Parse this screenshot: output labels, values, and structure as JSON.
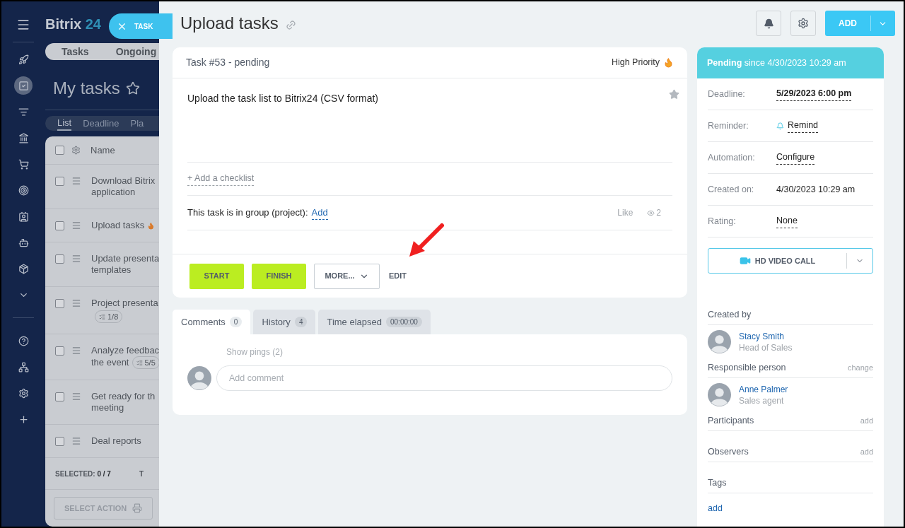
{
  "background": {
    "logo": {
      "name": "Bitrix",
      "number": "24"
    },
    "close_task": {
      "label": "TASK"
    },
    "nav": [
      {
        "kind": "menu",
        "selected": false
      },
      {
        "kind": "feed",
        "selected": false
      },
      {
        "kind": "tasks",
        "selected": true
      },
      {
        "kind": "funnel",
        "selected": false
      },
      {
        "kind": "bank",
        "selected": false
      },
      {
        "kind": "cart",
        "selected": false
      },
      {
        "kind": "target",
        "selected": false
      },
      {
        "kind": "contact",
        "selected": false
      },
      {
        "kind": "robot",
        "selected": false
      },
      {
        "kind": "box",
        "selected": false
      },
      {
        "kind": "more",
        "selected": false
      },
      {
        "kind": "help",
        "selected": false
      },
      {
        "kind": "network",
        "selected": false
      },
      {
        "kind": "settings",
        "selected": false
      },
      {
        "kind": "add",
        "selected": false
      }
    ],
    "top_tabs": [
      {
        "label": "Tasks"
      },
      {
        "label": "Ongoing"
      }
    ],
    "page_title": "My tasks",
    "view_tabs": [
      {
        "label": "List",
        "selected": true
      },
      {
        "label": "Deadline",
        "selected": false
      },
      {
        "label": "Pla",
        "selected": false
      }
    ],
    "list_header": "Name",
    "header_checked": false,
    "rows": [
      {
        "title": "Download Bitrix",
        "title_line_2": "application",
        "hot": false,
        "checked": false
      },
      {
        "title": "Upload tasks",
        "hot": true,
        "checked": false
      },
      {
        "title": "Update presenta",
        "title_line_2": "templates",
        "hot": false,
        "checked": false
      },
      {
        "title": "Project presenta",
        "badge": "1/8",
        "hot": false,
        "checked": false
      },
      {
        "title": "Analyze feedbac",
        "title_line_2": "the event",
        "badge": "5/5",
        "hot": false,
        "checked": false
      },
      {
        "title": "Get ready for th",
        "title_line_2": "meeting",
        "hot": false,
        "checked": false
      },
      {
        "title": "Deal reports",
        "hot": false,
        "checked": false
      }
    ],
    "footer": {
      "selected_label": "SELECTED:",
      "selected_value": "0 / 7",
      "total_label": "T"
    },
    "action_button": "SELECT ACTION"
  },
  "panel": {
    "title": "Upload tasks",
    "add_button": "ADD",
    "task": {
      "header": "Task #53 - pending",
      "priority": "High Priority",
      "description": "Upload the task list to Bitrix24 (CSV format)",
      "checklist_link": "+ Add a checklist",
      "group_label": "This task is in group (project):",
      "group_link": "Add",
      "like": "Like",
      "views": "2",
      "buttons": [
        {
          "label": "START",
          "kind": "primary"
        },
        {
          "label": "FINISH",
          "kind": "primary"
        },
        {
          "label": "MORE...",
          "kind": "menu"
        },
        {
          "label": "EDIT",
          "kind": "plain"
        }
      ]
    },
    "tabs": [
      {
        "label": "Comments",
        "count": "0",
        "selected": true
      },
      {
        "label": "History",
        "count": "4",
        "selected": false
      },
      {
        "label": "Time elapsed",
        "count": "00:00:00",
        "selected": false
      }
    ],
    "comments": {
      "show_pings": "Show pings (2)",
      "placeholder": "Add comment"
    },
    "status": "**Pending** since 4/30/2023 10:29 am",
    "fields": [
      {
        "label": "Deadline:",
        "value": "5/29/2023 6:00 pm",
        "kind": "deadline"
      },
      {
        "label": "Reminder:",
        "value": "Remind",
        "kind": "reminder"
      },
      {
        "label": "Automation:",
        "value": "Configure",
        "kind": "link"
      },
      {
        "label": "Created on:",
        "value": "4/30/2023 10:29 am",
        "kind": "text"
      },
      {
        "label": "Rating:",
        "value": "None",
        "kind": "link"
      }
    ],
    "video_call": "HD VIDEO CALL",
    "sections": [
      {
        "title": "Created by",
        "person": {
          "name": "Stacy Smith",
          "role": "Head of Sales"
        }
      },
      {
        "title": "Responsible person",
        "action": "change",
        "person": {
          "name": "Anne Palmer",
          "role": "Sales agent"
        }
      },
      {
        "title": "Participants",
        "action": "add"
      },
      {
        "title": "Observers",
        "action": "add"
      },
      {
        "title": "Tags",
        "link": "add"
      }
    ]
  }
}
